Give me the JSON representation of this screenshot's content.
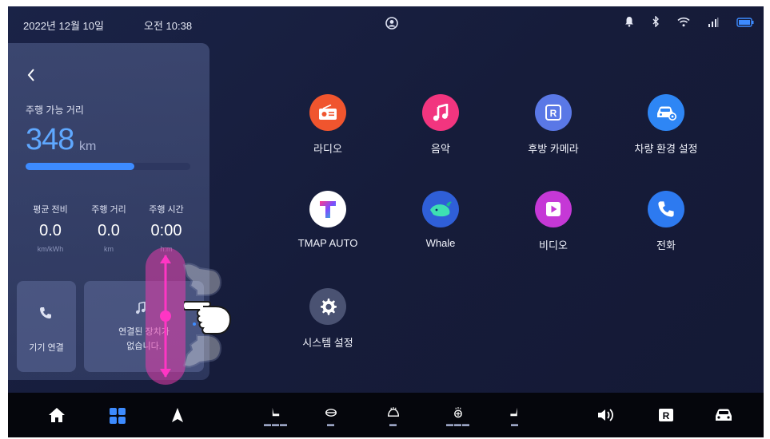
{
  "status_bar": {
    "date": "2022년 12월 10일",
    "time": "오전 10:38",
    "icons": [
      "profile-icon",
      "bell-icon",
      "bluetooth-icon",
      "wifi-icon",
      "signal-icon",
      "battery-icon"
    ]
  },
  "trip_panel": {
    "range_label": "주행 가능 거리",
    "range_value": "348",
    "range_unit": "km",
    "range_fill_fraction": 0.66,
    "stats": [
      {
        "label": "평균 전비",
        "value": "0.0",
        "unit": "km/kWh"
      },
      {
        "label": "주행 거리",
        "value": "0.0",
        "unit": "km"
      },
      {
        "label": "주행 시간",
        "value": "0:00",
        "unit": "h:m"
      }
    ],
    "device_connect_label": "기기 연결",
    "no_device_text_line1": "연결된 장치가",
    "no_device_text_line2": "없습니다."
  },
  "apps": [
    {
      "label": "라디오",
      "icon": "radio-icon",
      "color": "#f0552e"
    },
    {
      "label": "음악",
      "icon": "music-icon",
      "color": "#f2357f"
    },
    {
      "label": "후방 카메라",
      "icon": "rear-camera-icon",
      "color": "#5a78e6"
    },
    {
      "label": "차량 환경 설정",
      "icon": "car-settings-icon",
      "color": "#2e86f5"
    },
    {
      "label": "TMAP AUTO",
      "icon": "tmap-icon",
      "color": "#ffffff"
    },
    {
      "label": "Whale",
      "icon": "whale-icon",
      "color": "#2f5fd8"
    },
    {
      "label": "비디오",
      "icon": "video-icon",
      "color": "#c538d6"
    },
    {
      "label": "전화",
      "icon": "phone-icon",
      "color": "#2d7af0"
    },
    {
      "label": "시스템 설정",
      "icon": "gear-icon",
      "color": "#4a5272"
    }
  ],
  "dock": {
    "items": [
      "home-icon",
      "apps-grid-icon",
      "navigation-icon",
      "seat-heat-icon",
      "steering-heat-icon",
      "defrost-icon",
      "seat-vent-icon",
      "seat-recline-icon",
      "volume-icon",
      "rear-camera-icon",
      "car-icon"
    ]
  }
}
